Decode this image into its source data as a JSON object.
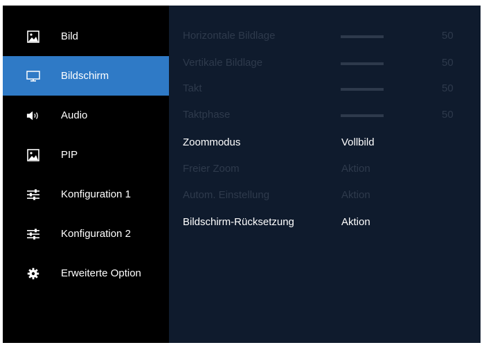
{
  "sidebar": {
    "items": [
      {
        "label": "Bild",
        "icon": "picture-icon",
        "active": false
      },
      {
        "label": "Bildschirm",
        "icon": "monitor-icon",
        "active": true
      },
      {
        "label": "Audio",
        "icon": "speaker-icon",
        "active": false
      },
      {
        "label": "PIP",
        "icon": "picture-icon",
        "active": false
      },
      {
        "label": "Konfiguration 1",
        "icon": "sliders-icon",
        "active": false
      },
      {
        "label": "Konfiguration 2",
        "icon": "sliders-icon",
        "active": false
      },
      {
        "label": "Erweiterte Option",
        "icon": "gear-icon",
        "active": false
      }
    ]
  },
  "settings": {
    "horizontal_position": {
      "label": "Horizontale Bildlage",
      "value": "50",
      "level": 50
    },
    "vertical_position": {
      "label": "Vertikale Bildlage",
      "value": "50",
      "level": 50
    },
    "clock": {
      "label": "Takt",
      "value": "50",
      "level": 50
    },
    "phase": {
      "label": "Taktphase",
      "value": "50",
      "level": 50
    },
    "zoom_mode": {
      "label": "Zoommodus",
      "value": "Vollbild"
    },
    "free_zoom": {
      "label": "Freier Zoom",
      "value": "Aktion"
    },
    "auto_adjust": {
      "label": "Autom. Einstellung",
      "value": "Aktion"
    },
    "screen_reset": {
      "label": "Bildschirm-Rücksetzung",
      "value": "Aktion"
    }
  },
  "colors": {
    "background": "#000000",
    "panel": "#0f1b2d",
    "active_item": "#2f7ac6",
    "disabled_text": "#2e3a4c",
    "text": "#ffffff"
  }
}
